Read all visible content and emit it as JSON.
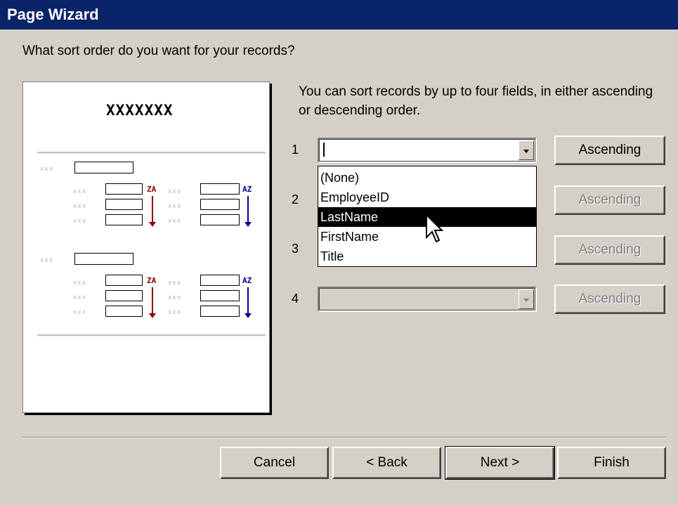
{
  "window": {
    "title": "Page Wizard"
  },
  "question": "What sort order do you want for your records?",
  "description": "You can sort records by up to four fields, in either ascending or descending order.",
  "preview": {
    "title": "XXXXXXX",
    "placeholder": "xxx",
    "descending_label": "ZA",
    "ascending_label": "AZ"
  },
  "sort_rows": [
    {
      "number": "1",
      "value": "",
      "button": "Ascending",
      "enabled": true
    },
    {
      "number": "2",
      "value": "",
      "button": "Ascending",
      "enabled": false
    },
    {
      "number": "3",
      "value": "",
      "button": "Ascending",
      "enabled": false
    },
    {
      "number": "4",
      "value": "",
      "button": "Ascending",
      "enabled": false
    }
  ],
  "dropdown": {
    "options": [
      "(None)",
      "EmployeeID",
      "LastName",
      "FirstName",
      "Title"
    ],
    "highlighted": "LastName"
  },
  "footer": {
    "cancel": "Cancel",
    "back": "< Back",
    "next": "Next >",
    "finish": "Finish"
  },
  "icons": {
    "dropdown_arrow": "chevron-down-icon",
    "sort_descending": "arrow-down-icon",
    "sort_ascending": "arrow-down-icon",
    "cursor": "mouse-pointer-icon"
  },
  "colors": {
    "titlebar": "#0a246a",
    "dialog": "#d4d0c8",
    "descending": "#8b0000",
    "ascending": "#00008b"
  }
}
